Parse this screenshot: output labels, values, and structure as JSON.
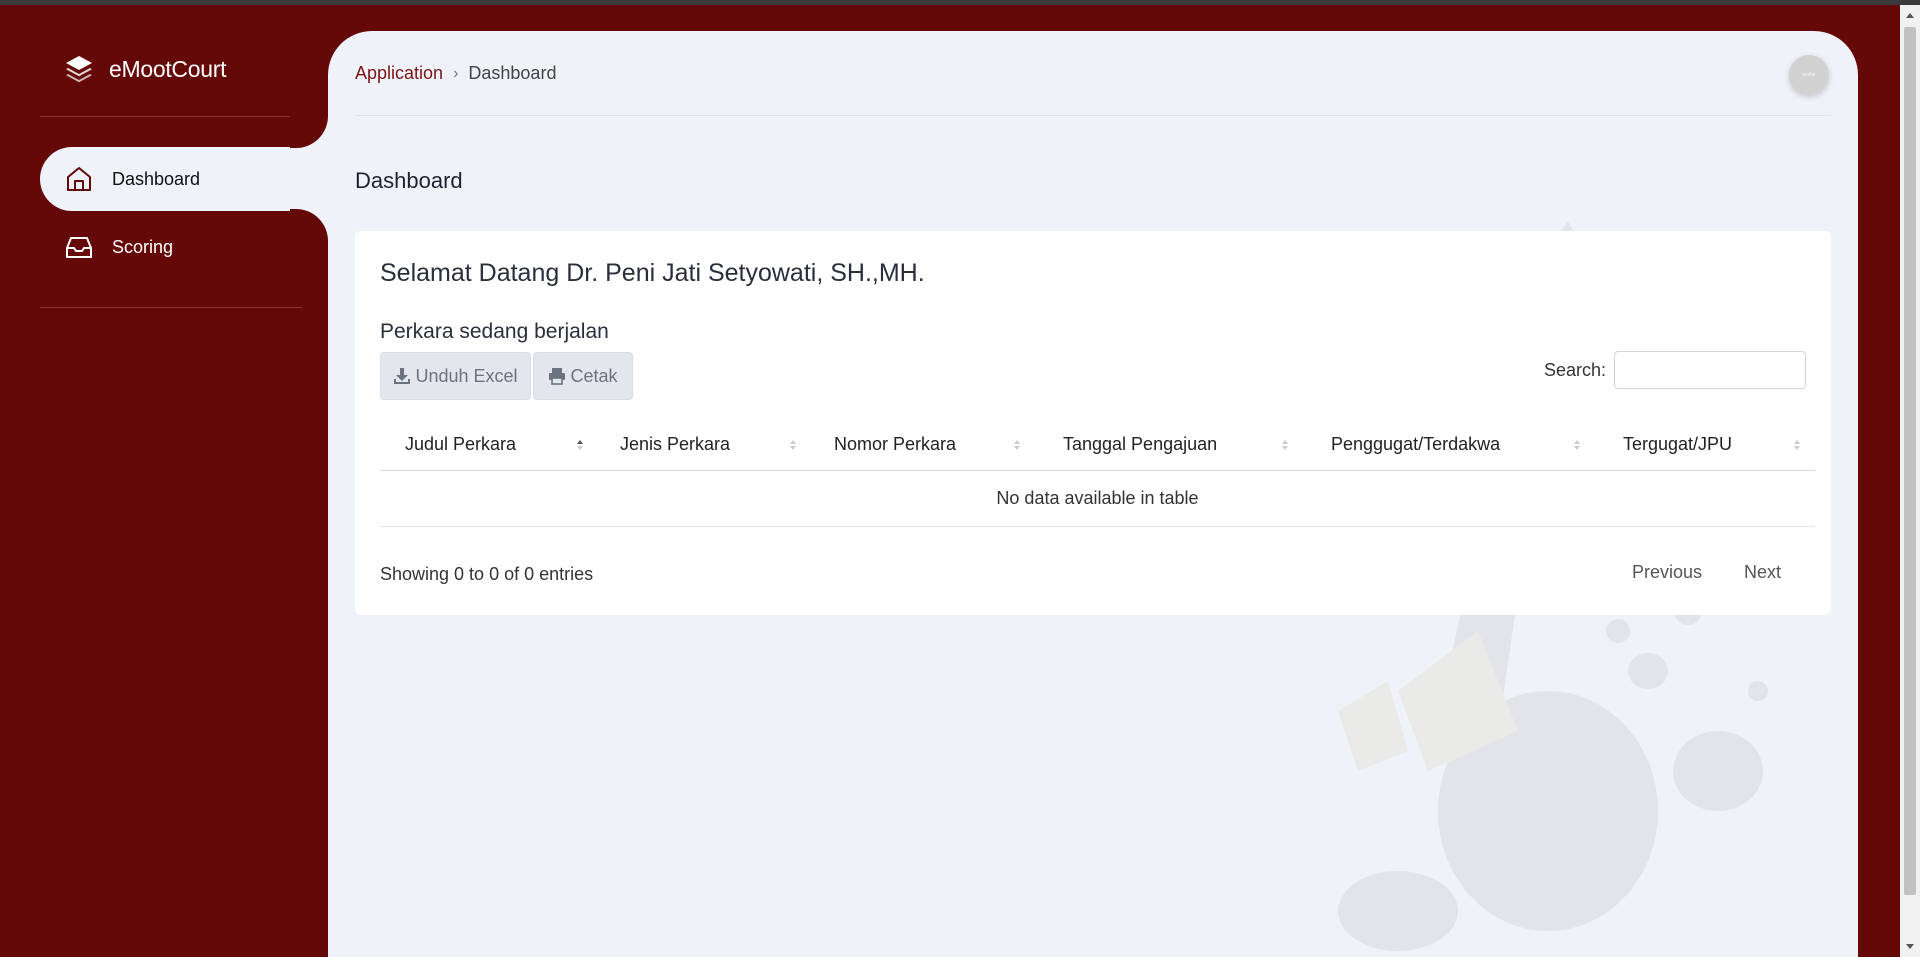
{
  "brand": {
    "title": "eMootCourt",
    "icon": "layers-icon"
  },
  "sidebar": {
    "items": [
      {
        "label": "Dashboard",
        "icon": "home-icon",
        "active": true
      },
      {
        "label": "Scoring",
        "icon": "inbox-icon",
        "active": false
      }
    ]
  },
  "header": {
    "breadcrumb": {
      "root": "Application",
      "separator": "›",
      "current": "Dashboard"
    },
    "avatar_text": "avatar"
  },
  "page": {
    "title": "Dashboard"
  },
  "card": {
    "welcome": "Selamat Datang Dr. Peni Jati Setyowati, SH.,MH.",
    "subtitle": "Perkara sedang berjalan",
    "buttons": {
      "excel": "Unduh Excel",
      "print": "Cetak"
    },
    "search": {
      "label": "Search:",
      "value": "",
      "placeholder": ""
    },
    "table": {
      "columns": [
        "Judul Perkara",
        "Jenis Perkara",
        "Nomor Perkara",
        "Tanggal Pengajuan",
        "Penggugat/Terdakwa",
        "Tergugat/JPU"
      ],
      "empty_message": "No data available in table"
    },
    "info": "Showing 0 to 0 of 0 entries",
    "pagination": {
      "previous": "Previous",
      "next": "Next"
    }
  },
  "colors": {
    "sidebar": "#650808",
    "accent": "#7a1515",
    "panel": "#eff2f8",
    "card": "#ffffff"
  }
}
